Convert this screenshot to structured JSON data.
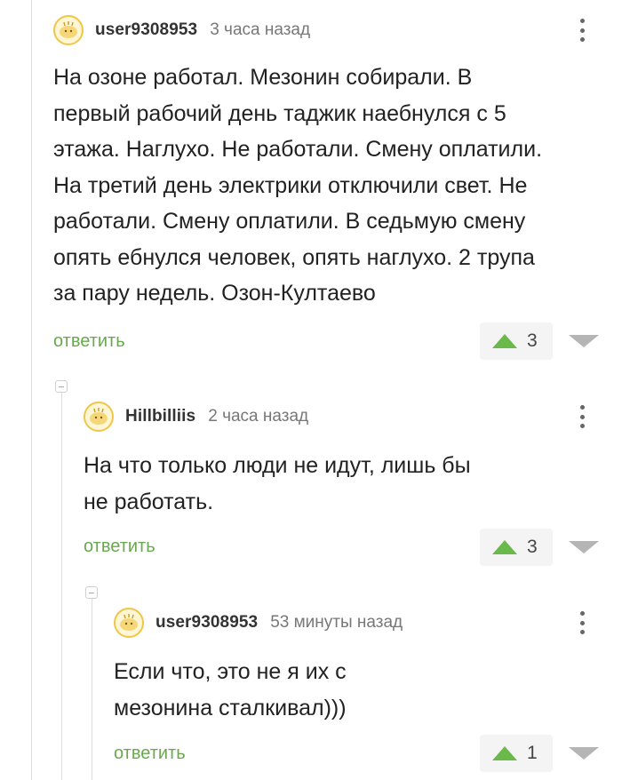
{
  "comments": [
    {
      "username": "user9308953",
      "time": "3 часа назад",
      "lines": [
        "На озоне работал. Мезонин собирали. В",
        "первый рабочий день таджик наебнулся с 5",
        "этажа. Наглухо. Не работали. Смену оплатили.",
        "На третий день электрики отключили свет. Не",
        "работали. Смену оплатили. В седьмую смену",
        "опять ебнулся человек, опять наглухо. 2 трупа",
        "за пару недель. Озон-Култаево"
      ],
      "reply_label": "ответить",
      "rating": "3"
    },
    {
      "username": "Hillbilliis",
      "time": "2 часа назад",
      "lines": [
        "На что только люди не идут, лишь бы",
        "не работать."
      ],
      "reply_label": "ответить",
      "rating": "3"
    },
    {
      "username": "user9308953",
      "time": "53 минуты назад",
      "lines": [
        "Если что, это не я их с",
        "мезонина сталкивал)))"
      ],
      "reply_label": "ответить",
      "rating": "1"
    }
  ],
  "icons": {
    "avatar": "avatar-icon",
    "more": "more-vertical-icon",
    "upvote": "upvote-arrow-icon",
    "downvote": "downvote-arrow-icon",
    "collapse": "collapse-thread-icon"
  },
  "colors": {
    "reply_link": "#6aa84f",
    "upvote": "#6cb94b",
    "downvote": "#b5b5b5",
    "thread_line": "#dedede"
  }
}
